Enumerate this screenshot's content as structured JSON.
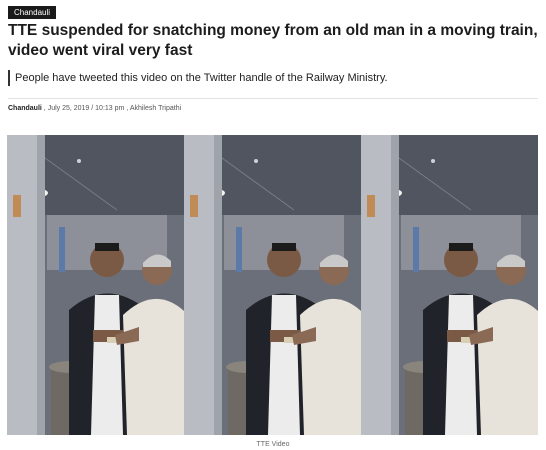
{
  "article": {
    "category_tag": "Chandauli",
    "headline": "TTE suspended for snatching money from an old man in a moving train, video went viral very fast",
    "summary": "People have tweeted this video on the Twitter handle of the Railway Ministry.",
    "byline": {
      "location": "Chandauli",
      "separator": " , ",
      "date_time": "July 25, 2019 / 10:13 pm",
      "separator2": " , ",
      "author": "Akhilesh Tripathi"
    },
    "image_caption": "TTE Video"
  },
  "colors": {
    "tag_bg": "#1a1a1a",
    "coach_ceiling": "#50555f",
    "coach_wall": "#8d9099",
    "door_panel": "#b9bcc2",
    "jacket": "#20232a",
    "white_kurta": "#e7e3db"
  }
}
